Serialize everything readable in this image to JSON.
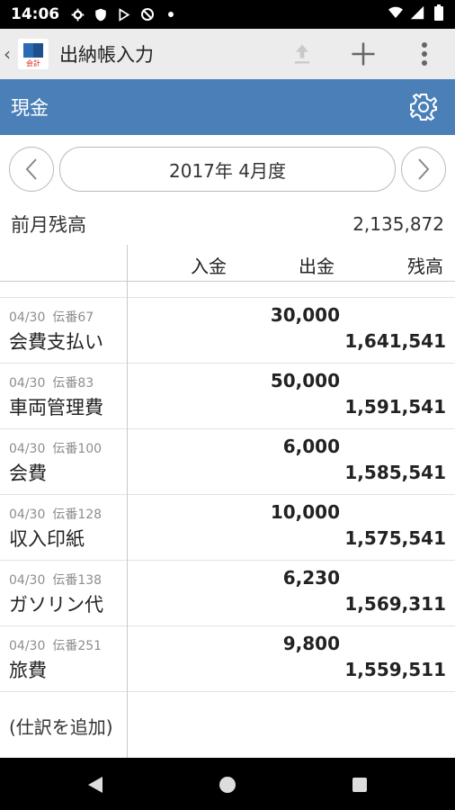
{
  "status_bar": {
    "time": "14:06",
    "left_icons": [
      "gear-icon",
      "shield-icon",
      "play-store-icon",
      "blocked-icon",
      "dot-icon"
    ],
    "right_icons": [
      "wifi-icon",
      "signal-icon",
      "battery-icon"
    ]
  },
  "app_bar": {
    "title": "出納帳入力",
    "logo_text": "会計",
    "actions": [
      "upload-icon",
      "add-icon",
      "more-vert-icon"
    ]
  },
  "account": {
    "title": "現金"
  },
  "period": {
    "label": "2017年 4月度"
  },
  "previous_balance": {
    "label": "前月残高",
    "value": "2,135,872"
  },
  "table": {
    "columns": {
      "deposit": "入金",
      "withdrawal": "出金",
      "balance": "残高"
    },
    "entries": [
      {
        "date": "04/30",
        "slip": "伝番67",
        "name": "会費支払い",
        "withdrawal": "30,000",
        "balance": "1,641,541"
      },
      {
        "date": "04/30",
        "slip": "伝番83",
        "name": "車両管理費",
        "withdrawal": "50,000",
        "balance": "1,591,541"
      },
      {
        "date": "04/30",
        "slip": "伝番100",
        "name": "会費",
        "withdrawal": "6,000",
        "balance": "1,585,541"
      },
      {
        "date": "04/30",
        "slip": "伝番128",
        "name": "収入印紙",
        "withdrawal": "10,000",
        "balance": "1,575,541"
      },
      {
        "date": "04/30",
        "slip": "伝番138",
        "name": "ガソリン代",
        "withdrawal": "6,230",
        "balance": "1,569,311"
      },
      {
        "date": "04/30",
        "slip": "伝番251",
        "name": "旅費",
        "withdrawal": "9,800",
        "balance": "1,559,511"
      }
    ],
    "add_entry_label": "(仕訳を追加)"
  },
  "colors": {
    "accent": "#4a7fb8",
    "app_bar_bg": "#ececec"
  }
}
